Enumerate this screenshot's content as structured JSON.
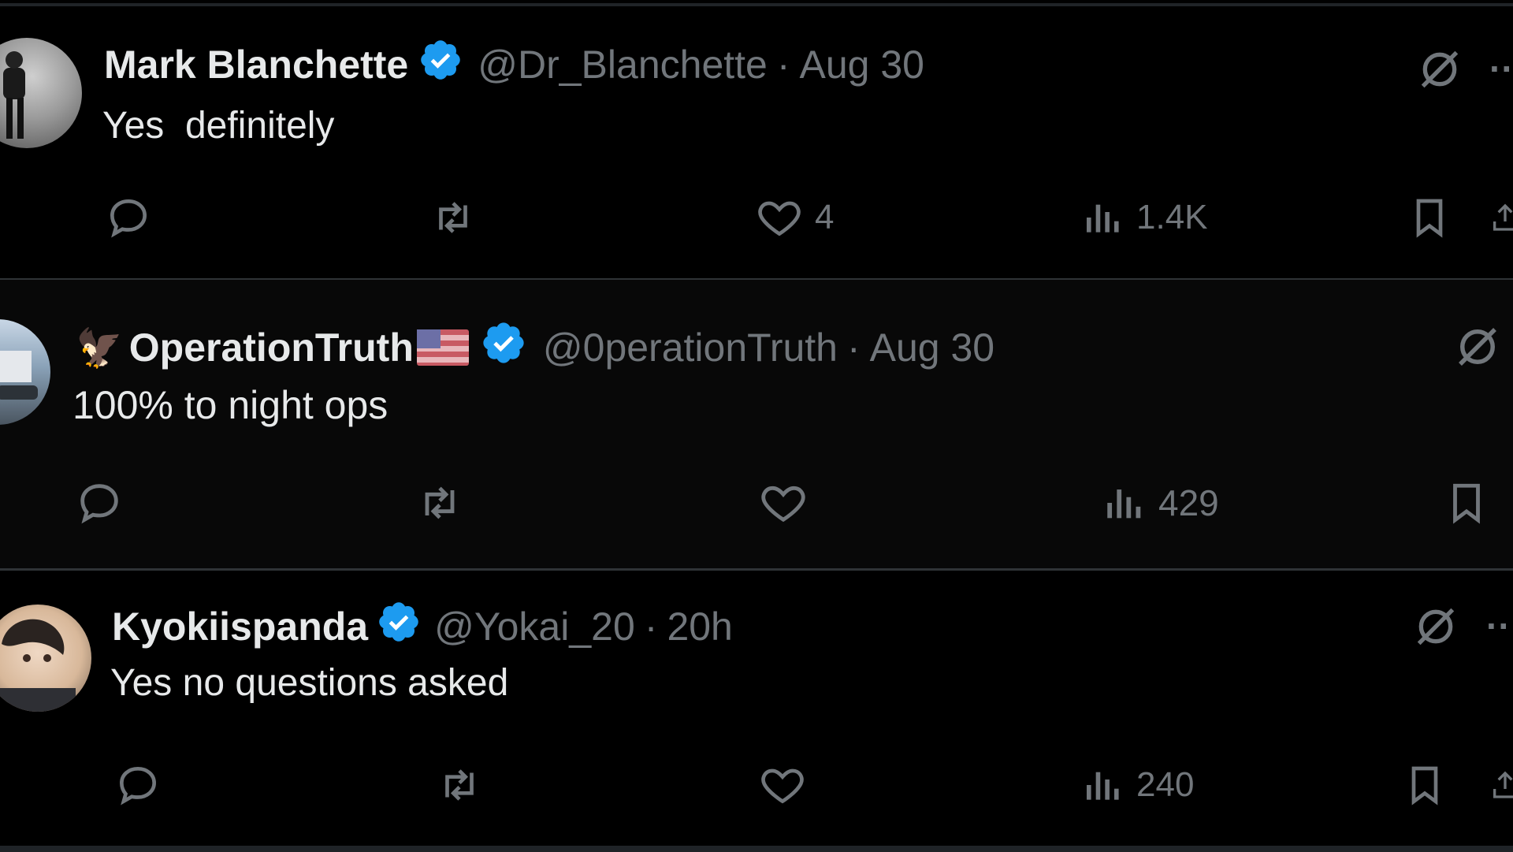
{
  "tweets": [
    {
      "name": "Mark Blanchette",
      "handle": "@Dr_Blanchette",
      "separator": "·",
      "time": "Aug 30",
      "text": "Yes  definitely",
      "likes": "4",
      "views": "1.4K"
    },
    {
      "name_prefix_emoji": "🦅",
      "name": "OperationTruth",
      "name_suffix_emoji": "🇺🇸",
      "handle": "@0perationTruth",
      "separator": "·",
      "time": "Aug 30",
      "text": "100% to night ops",
      "likes": "",
      "views": "429"
    },
    {
      "name": "Kyokiispanda",
      "handle": "@Yokai_20",
      "separator": "·",
      "time": "20h",
      "text": "Yes no questions asked",
      "likes": "",
      "views": "240"
    }
  ],
  "icons": {
    "reply": "reply-icon",
    "repost": "repost-icon",
    "like": "heart-icon",
    "views": "views-icon",
    "bookmark": "bookmark-icon",
    "share": "share-icon",
    "grok": "grok-icon",
    "verified": "verified-badge-icon",
    "more": "more-icon"
  },
  "colors": {
    "background": "#000000",
    "text": "#e7e9ea",
    "muted": "#71767b",
    "verified": "#1d9bf0",
    "divider": "#2f3336"
  }
}
